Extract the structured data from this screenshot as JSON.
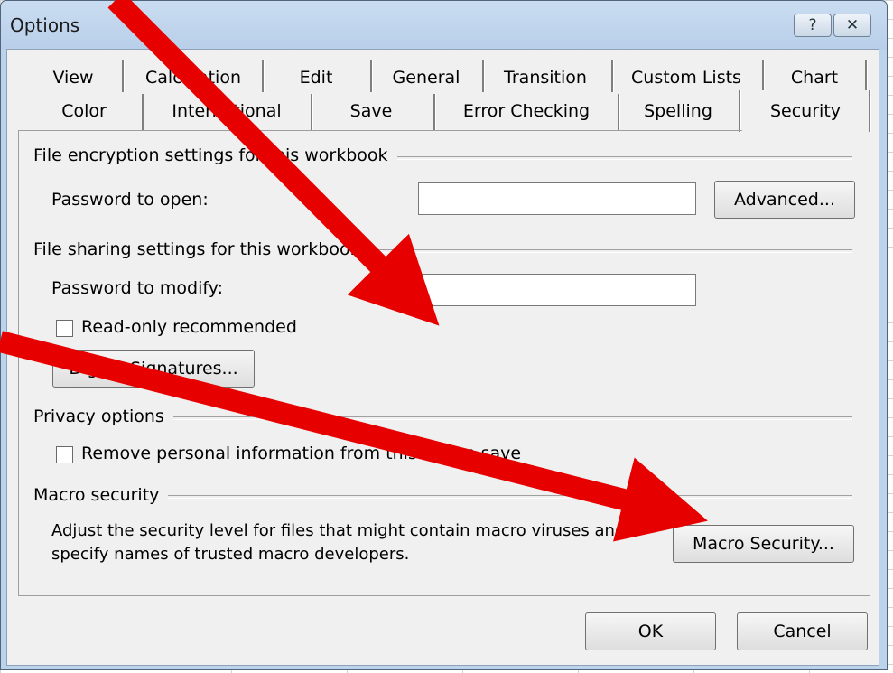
{
  "window": {
    "title": "Options",
    "help_glyph": "?",
    "close_glyph": "✕"
  },
  "tabs_row1": [
    "View",
    "Calculation",
    "Edit",
    "General",
    "Transition",
    "Custom Lists",
    "Chart"
  ],
  "tabs_row2": [
    "Color",
    "International",
    "Save",
    "Error Checking",
    "Spelling",
    "Security"
  ],
  "selected_tab": "Security",
  "encryption": {
    "group_label": "File encryption settings for this workbook",
    "password_open_label": "Password to open:",
    "password_open_value": "",
    "advanced_button": "Advanced..."
  },
  "sharing": {
    "group_label": "File sharing settings for this workbook",
    "password_modify_label": "Password to modify:",
    "password_modify_value": "",
    "readonly_label": "Read-only recommended",
    "readonly_checked": false,
    "digital_signatures_button": "Digital Signatures..."
  },
  "privacy": {
    "group_label": "Privacy options",
    "remove_info_label": "Remove personal information from this file on save",
    "remove_info_checked": false
  },
  "macro": {
    "group_label": "Macro security",
    "description_line1": "Adjust the security level for files that might contain macro viruses and",
    "description_line2": "specify names of trusted macro developers.",
    "macro_security_button": "Macro Security..."
  },
  "footer": {
    "ok_button": "OK",
    "cancel_button": "Cancel"
  },
  "colors": {
    "arrow": "#e60000",
    "window_frame": "#bcd3ec",
    "client": "#f0f0f0"
  }
}
